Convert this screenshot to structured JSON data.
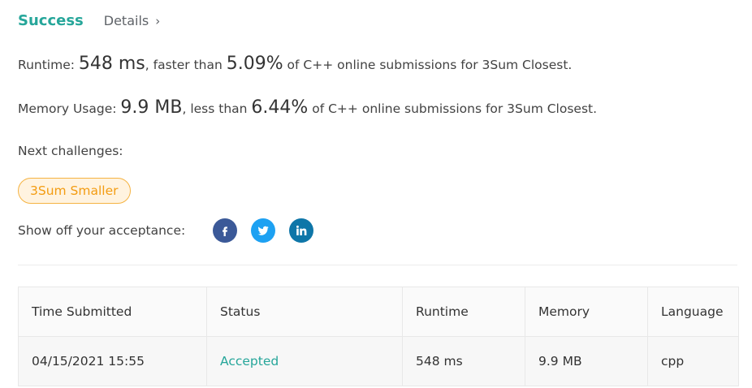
{
  "header": {
    "status": "Success",
    "details_label": "Details",
    "details_chevron": "›"
  },
  "runtime": {
    "label": "Runtime: ",
    "value": "548 ms",
    "mid": ", faster than ",
    "percent": "5.09%",
    "suffix": " of C++ online submissions for 3Sum Closest."
  },
  "memory": {
    "label": "Memory Usage: ",
    "value": "9.9 MB",
    "mid": ", less than ",
    "percent": "6.44%",
    "suffix": " of C++ online submissions for 3Sum Closest."
  },
  "next_challenges": {
    "label": "Next challenges:",
    "items": [
      "3Sum Smaller"
    ]
  },
  "share": {
    "label": "Show off your acceptance:",
    "icons": [
      "facebook-icon",
      "twitter-icon",
      "linkedin-icon"
    ]
  },
  "colors": {
    "success": "#26a69a",
    "chip_border": "#f5b342",
    "chip_text": "#f39c12",
    "facebook": "#3b5998",
    "twitter": "#1da1f2",
    "linkedin": "#0e76a8"
  },
  "table": {
    "headers": [
      "Time Submitted",
      "Status",
      "Runtime",
      "Memory",
      "Language"
    ],
    "rows": [
      [
        "04/15/2021 15:55",
        "Accepted",
        "548 ms",
        "9.9 MB",
        "cpp"
      ]
    ]
  }
}
